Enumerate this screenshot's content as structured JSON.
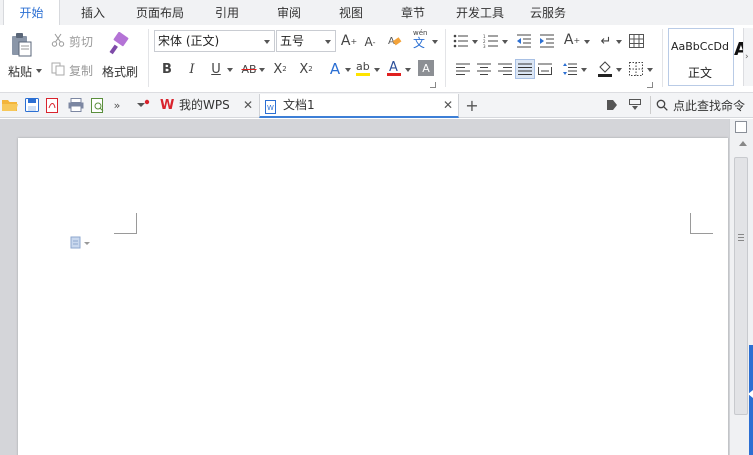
{
  "menu": {
    "tabs": [
      "开始",
      "插入",
      "页面布局",
      "引用",
      "审阅",
      "视图",
      "章节",
      "开发工具",
      "云服务"
    ],
    "active_tab": "开始"
  },
  "clipboard": {
    "paste_label": "粘贴",
    "cut_label": "剪切",
    "copy_label": "复制",
    "format_painter_label": "格式刷"
  },
  "font": {
    "family": "宋体 (正文)",
    "size": "五号",
    "wen_label": "wén",
    "wen_char": "文"
  },
  "styles": {
    "preview_text": "AaBbCcDd",
    "style_name": "正文"
  },
  "doc_tabs": {
    "my_wps_label": "我的WPS",
    "doc_label": "文档1",
    "search_label": "点此查找命令"
  },
  "colors": {
    "accent": "#2b6fd3",
    "wps_red": "#d9232d",
    "highlight_yellow": "#ffe400",
    "font_red": "#e02020",
    "workspace_bg": "#d4d5d9"
  },
  "icons": {
    "paste": "clipboard-icon",
    "cut": "scissors-icon",
    "copy": "copy-icon",
    "format_painter": "brush-icon",
    "open": "folder-icon",
    "save": "save-icon",
    "print": "printer-icon",
    "search": "magnifier-icon"
  }
}
